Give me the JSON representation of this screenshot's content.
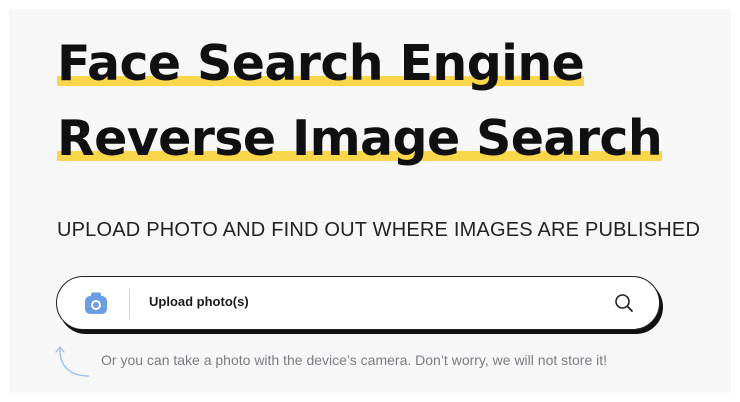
{
  "hero": {
    "line1": "Face Search Engine",
    "line2": "Reverse Image Search"
  },
  "subtitle": "UPLOAD PHOTO AND FIND OUT WHERE IMAGES ARE PUBLISHED",
  "search_bar": {
    "camera_icon": "camera-icon",
    "upload_label": "Upload photo(s)",
    "search_icon": "search-icon"
  },
  "hint": "Or you can take a photo with the device’s camera. Don’t worry, we will not store it!",
  "colors": {
    "highlight": "#f9d64a",
    "camera_icon": "#6a9ee6",
    "hint_text": "#7a7d86"
  }
}
